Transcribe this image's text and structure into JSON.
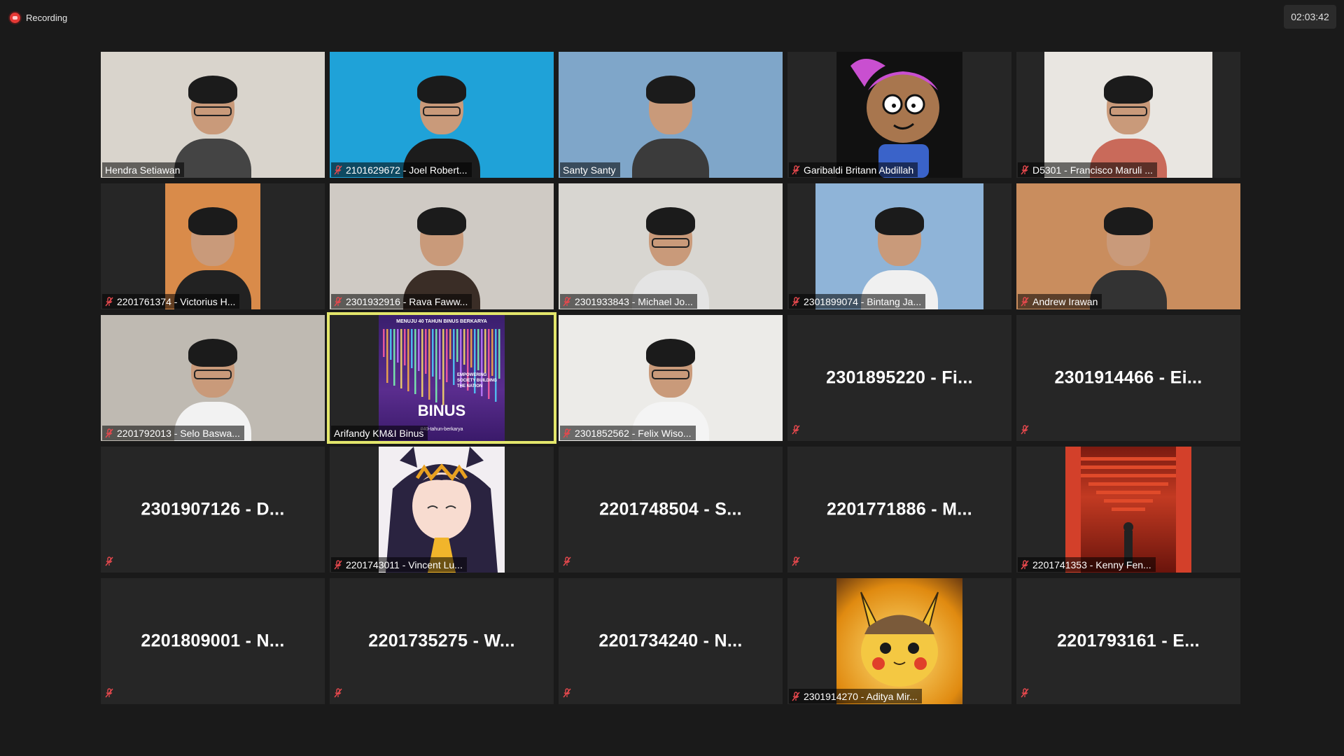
{
  "recording": {
    "label": "Recording"
  },
  "timer": {
    "value": "02:03:42"
  },
  "participants": [
    {
      "name": "Hendra Setiawan",
      "muted": false,
      "video": "full",
      "bg": "#d9d4cc",
      "shirt": "#444444",
      "glasses": true
    },
    {
      "name": "2101629672 - Joel Robert...",
      "muted": true,
      "video": "full",
      "bg": "#1fa2d8",
      "shirt": "#1c1c1c",
      "glasses": true
    },
    {
      "name": "Santy Santy",
      "muted": false,
      "video": "full",
      "bg": "#7fa6c9",
      "shirt": "#3b3b3b",
      "glasses": false
    },
    {
      "name": "Garibaldi Britann Abdillah",
      "muted": true,
      "video": "square",
      "bg": "#111111",
      "cartoon": true
    },
    {
      "name": "D5301 - Francisco Maruli ...",
      "muted": true,
      "video": "wide",
      "bg": "#e9e6e1",
      "shirt": "#c96a5a",
      "glasses": true
    },
    {
      "name": "2201761374 - Victorius H...",
      "muted": true,
      "video": "narrow",
      "bg": "#d98b4a",
      "shirt": "#222222",
      "glasses": false
    },
    {
      "name": "2301932916 - Rava Faww...",
      "muted": true,
      "video": "full",
      "bg": "#cfcac4",
      "shirt": "#3a2d26",
      "glasses": false
    },
    {
      "name": "2301933843 - Michael Jo...",
      "muted": true,
      "video": "full",
      "bg": "#d8d6d1",
      "shirt": "#e4e4e4",
      "glasses": true
    },
    {
      "name": "2301899074 - Bintang Ja...",
      "muted": true,
      "video": "wide",
      "bg": "#8fb4d8",
      "shirt": "#f0f0f0",
      "glasses": false
    },
    {
      "name": "Andrew Irawan",
      "muted": true,
      "video": "full",
      "bg": "#c98d5e",
      "shirt": "#333333",
      "glasses": false
    },
    {
      "name": "2201792013 - Selo Baswa...",
      "muted": true,
      "video": "full",
      "bg": "#bfbab2",
      "shirt": "#f2f2f2",
      "glasses": true
    },
    {
      "name": "Arifandy KM&I Binus",
      "muted": false,
      "video": "square",
      "bg": "#4b2a7a",
      "speaking": true,
      "binus": true
    },
    {
      "name": "2301852562 - Felix Wiso...",
      "muted": true,
      "video": "full",
      "bg": "#ecebe8",
      "shirt": "#f4f4f4",
      "glasses": true
    },
    {
      "name": "2301895220 - Fi...",
      "muted": true,
      "video": "none"
    },
    {
      "name": "2301914466 - Ei...",
      "muted": true,
      "video": "none"
    },
    {
      "name": "2301907126 - D...",
      "muted": true,
      "video": "none"
    },
    {
      "name": "2201743011 - Vincent Lu...",
      "muted": true,
      "video": "square",
      "bg": "#f2eef2",
      "anime": true
    },
    {
      "name": "2201748504 - S...",
      "muted": true,
      "video": "none"
    },
    {
      "name": "2201771886 - M...",
      "muted": true,
      "video": "none"
    },
    {
      "name": "2201741353 - Kenny Fen...",
      "muted": true,
      "video": "square",
      "bg": "#b3321e",
      "torii": true
    },
    {
      "name": "2201809001 - N...",
      "muted": true,
      "video": "none"
    },
    {
      "name": "2201735275 - W...",
      "muted": true,
      "video": "none"
    },
    {
      "name": "2201734240 - N...",
      "muted": true,
      "video": "none"
    },
    {
      "name": "2301914270 - Aditya Mir...",
      "muted": true,
      "video": "square",
      "bg": "#e0a020",
      "pikachu": true
    },
    {
      "name": "2201793161 - E...",
      "muted": true,
      "video": "none"
    }
  ],
  "binus_tile": {
    "line1": "MENUJU 40 TAHUN BINUS BERKARYA",
    "line2": "EMPOWERING SOCIETY BUILDING THE NATION",
    "line3": "BINUS",
    "line4": "#40-tahun-berkarya"
  },
  "colors": {
    "speaking_border": "#e3e66b",
    "mute_red": "#e5484d",
    "tile_bg": "#262626",
    "page_bg": "#1a1a1a"
  }
}
